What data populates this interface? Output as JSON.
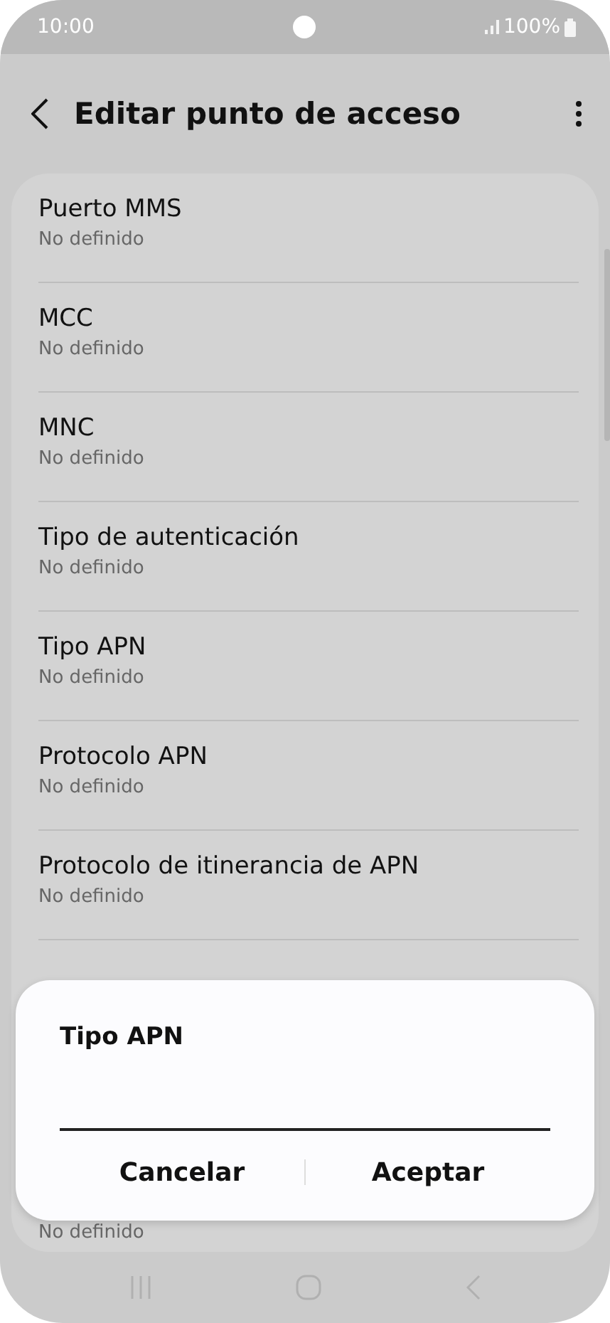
{
  "status_bar": {
    "time": "10:00",
    "battery": "100%"
  },
  "header": {
    "title": "Editar punto de acceso"
  },
  "items": [
    {
      "title": "Puerto MMS",
      "subtitle": "No definido"
    },
    {
      "title": "MCC",
      "subtitle": "No definido"
    },
    {
      "title": "MNC",
      "subtitle": "No definido"
    },
    {
      "title": "Tipo de autenticación",
      "subtitle": "No definido"
    },
    {
      "title": "Tipo APN",
      "subtitle": "No definido"
    },
    {
      "title": "Protocolo APN",
      "subtitle": "No definido"
    },
    {
      "title": "Protocolo de itinerancia de APN",
      "subtitle": "No definido"
    },
    {
      "subtitle": "No definido"
    }
  ],
  "dialog": {
    "title": "Tipo APN",
    "buttons": [
      "Cancelar",
      "Aceptar"
    ]
  }
}
